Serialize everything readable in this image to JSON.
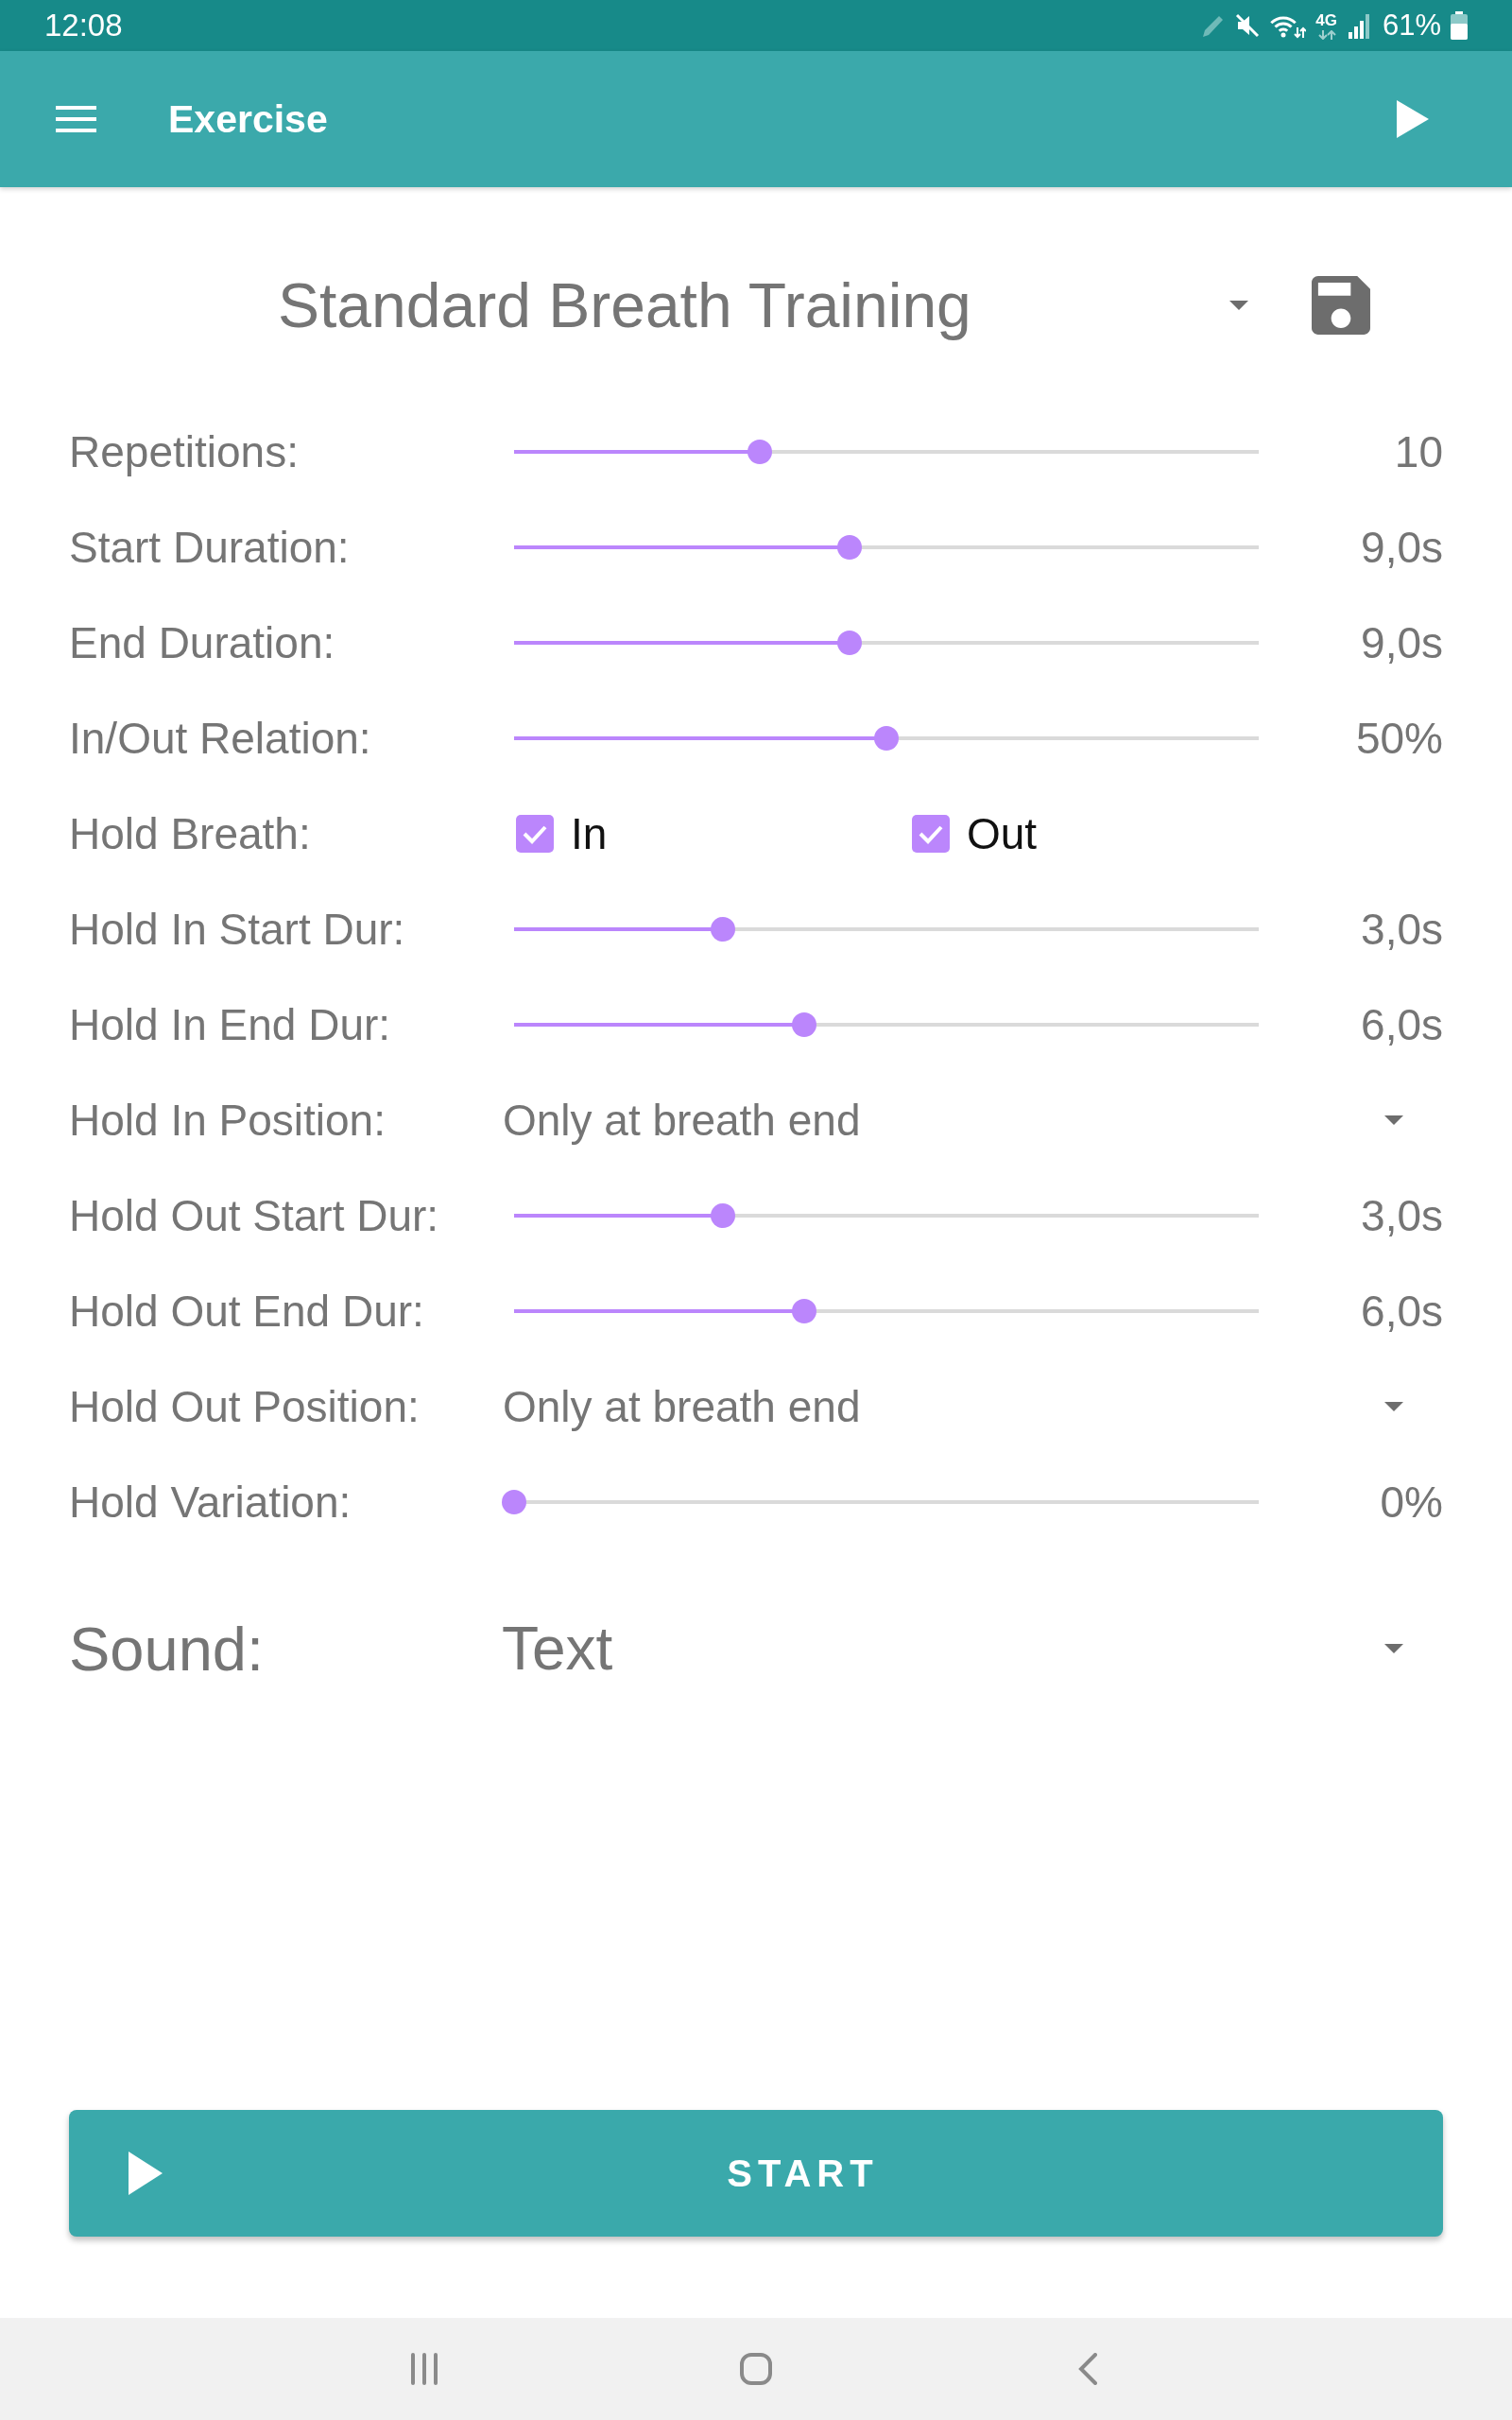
{
  "status_bar": {
    "time": "12:08",
    "network_type": "4G",
    "battery": "61%"
  },
  "app_bar": {
    "title": "Exercise"
  },
  "profile": {
    "name": "Standard Breath Training"
  },
  "settings": [
    {
      "kind": "slider",
      "label": "Repetitions:",
      "level": 0.33,
      "reading": "10"
    },
    {
      "kind": "slider",
      "label": "Start Duration:",
      "level": 0.45,
      "reading": "9,0s"
    },
    {
      "kind": "slider",
      "label": "End Duration:",
      "level": 0.45,
      "reading": "9,0s"
    },
    {
      "kind": "slider",
      "label": "In/Out Relation:",
      "level": 0.5,
      "reading": "50%"
    },
    {
      "kind": "checkboxes",
      "label": "Hold Breath:",
      "options": [
        {
          "label": "In",
          "checked": true
        },
        {
          "label": "Out",
          "checked": true
        }
      ]
    },
    {
      "kind": "slider",
      "label": "Hold In Start Dur:",
      "level": 0.28,
      "reading": "3,0s"
    },
    {
      "kind": "slider",
      "label": "Hold In End Dur:",
      "level": 0.39,
      "reading": "6,0s"
    },
    {
      "kind": "dropdown",
      "label": "Hold In Position:",
      "value": "Only at breath end"
    },
    {
      "kind": "slider",
      "label": "Hold Out Start Dur:",
      "level": 0.28,
      "reading": "3,0s"
    },
    {
      "kind": "slider",
      "label": "Hold Out End Dur:",
      "level": 0.39,
      "reading": "6,0s"
    },
    {
      "kind": "dropdown",
      "label": "Hold Out Position:",
      "value": "Only at breath end"
    },
    {
      "kind": "slider",
      "label": "Hold Variation:",
      "level": 0,
      "reading": "0%"
    }
  ],
  "sound": {
    "label": "Sound:",
    "value": "Text"
  },
  "start_button": {
    "label": "START"
  }
}
